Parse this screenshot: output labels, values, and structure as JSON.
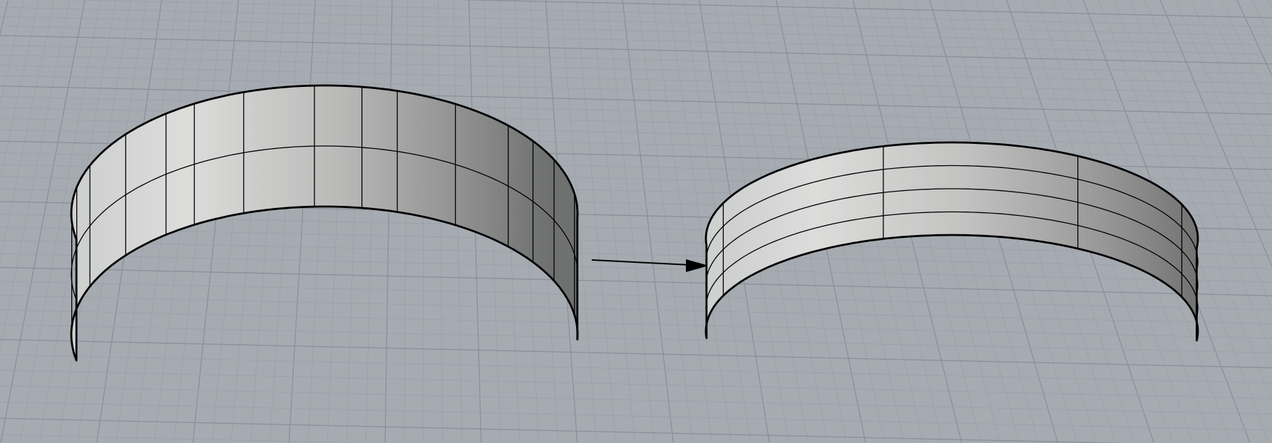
{
  "viewport": {
    "background_color": "#a6abb2",
    "grid_minor_color": "#9aa0a7",
    "grid_major_color": "#8a9098",
    "surface_outline_color": "#000000"
  },
  "scene": {
    "objects": [
      {
        "id": "source-surface",
        "kind": "curved-surface",
        "u_isocurves": 15,
        "v_isocurves": 1
      },
      {
        "id": "transform-arrow",
        "kind": "arrow"
      },
      {
        "id": "result-surface",
        "kind": "curved-surface",
        "u_isocurves": 3,
        "v_isocurves": 3
      }
    ]
  }
}
